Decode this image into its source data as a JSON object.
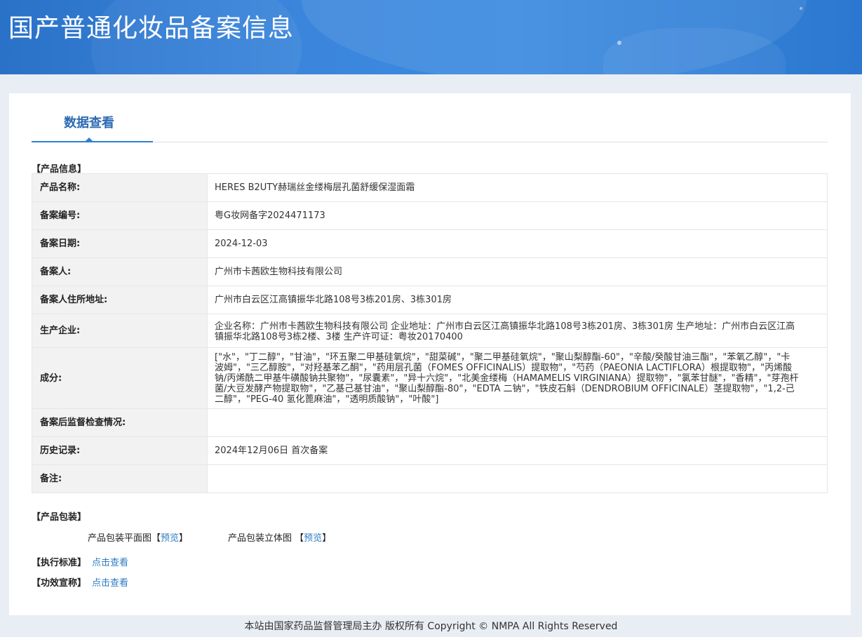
{
  "header": {
    "title": "国产普通化妆品备案信息"
  },
  "tabs": [
    {
      "label": "数据查看",
      "active": true
    }
  ],
  "product_info": {
    "section_title": "【产品信息】",
    "rows": [
      {
        "label": "产品名称:",
        "value": "HERES B2UTY赫瑞丝金缕梅层孔菌舒缓保湿面霜"
      },
      {
        "label": "备案编号:",
        "value": "粤G妆网备字2024471173"
      },
      {
        "label": "备案日期:",
        "value": "2024-12-03"
      },
      {
        "label": "备案人:",
        "value": "广州市卡茜欧生物科技有限公司"
      },
      {
        "label": "备案人住所地址:",
        "value": "广州市白云区江高镇振华北路108号3栋201房、3栋301房"
      },
      {
        "label": "生产企业:",
        "value": "企业名称：广州市卡茜欧生物科技有限公司 企业地址：广州市白云区江高镇振华北路108号3栋201房、3栋301房 生产地址：广州市白云区江高镇振华北路108号3栋2楼、3楼 生产许可证：粤妆20170400"
      },
      {
        "label": "成分:",
        "value": "[\"水\"，\"丁二醇\"，\"甘油\"，\"环五聚二甲基硅氧烷\"，\"甜菜碱\"，\"聚二甲基硅氧烷\"，\"聚山梨醇酯-60\"，\"辛酸/癸酸甘油三酯\"，\"苯氧乙醇\"，\"卡波姆\"，\"三乙醇胺\"，\"对羟基苯乙酮\"，\"药用层孔菌（FOMES OFFICINALIS）提取物\"，\"芍药（PAEONIA LACTIFLORA）根提取物\"，\"丙烯酸钠/丙烯酰二甲基牛磺酸钠共聚物\"，\"尿囊素\"，\"异十六烷\"，\"北美金缕梅（HAMAMELIS VIRGINIANA）提取物\"，\"氯苯甘醚\"，\"香精\"，\"芽孢杆菌/大豆发酵产物提取物\"，\"乙基己基甘油\"，\"聚山梨醇酯-80\"，\"EDTA 二钠\"，\"铁皮石斛（DENDROBIUM OFFICINALE）茎提取物\"，\"1,2-己二醇\"，\"PEG-40 氢化蓖麻油\"，\"透明质酸钠\"，\"叶酸\"]"
      },
      {
        "label": "备案后监督检查情况:",
        "value": ""
      },
      {
        "label": "历史记录:",
        "value": "2024年12月06日 首次备案"
      },
      {
        "label": "备注:",
        "value": ""
      }
    ]
  },
  "packaging": {
    "section_title": "【产品包装】",
    "flat_label": "产品包装平面图",
    "flat_link": "预览",
    "solid_label": "产品包装立体图",
    "solid_link": "预览",
    "bracket_open": "【",
    "bracket_close": "】"
  },
  "standard": {
    "label": "【执行标准】",
    "link": "点击查看"
  },
  "efficacy": {
    "label": "【功效宣称】",
    "link": "点击查看"
  },
  "footer": {
    "text": "本站由国家药品监督管理局主办 版权所有 Copyright © NMPA All Rights Reserved"
  }
}
